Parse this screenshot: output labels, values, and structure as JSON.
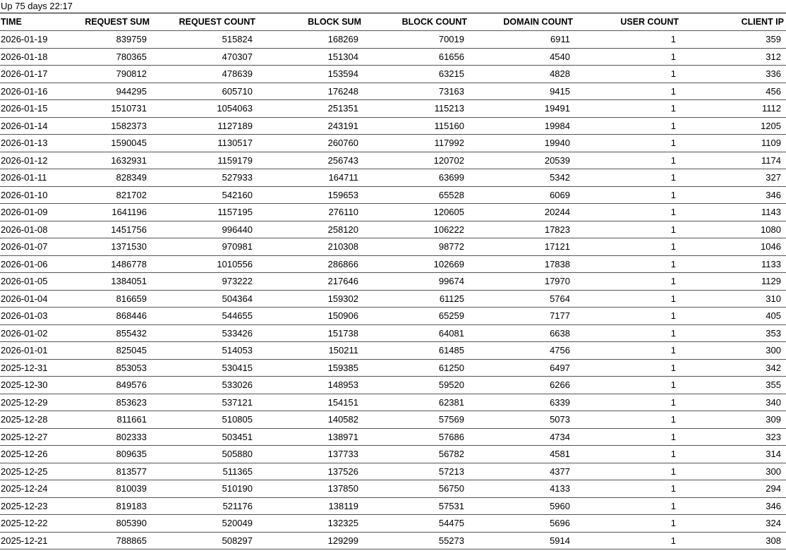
{
  "status": {
    "uptime": "Up 75 days 22:17"
  },
  "table": {
    "headers": [
      "TIME",
      "REQUEST SUM",
      "REQUEST COUNT",
      "BLOCK SUM",
      "BLOCK COUNT",
      "DOMAIN COUNT",
      "USER COUNT",
      "CLIENT IP"
    ],
    "rows": [
      [
        "2026-01-19",
        "839759",
        "515824",
        "168269",
        "70019",
        "6911",
        "1",
        "359"
      ],
      [
        "2026-01-18",
        "780365",
        "470307",
        "151304",
        "61656",
        "4540",
        "1",
        "312"
      ],
      [
        "2026-01-17",
        "790812",
        "478639",
        "153594",
        "63215",
        "4828",
        "1",
        "336"
      ],
      [
        "2026-01-16",
        "944295",
        "605710",
        "176248",
        "73163",
        "9415",
        "1",
        "456"
      ],
      [
        "2026-01-15",
        "1510731",
        "1054063",
        "251351",
        "115213",
        "19491",
        "1",
        "1112"
      ],
      [
        "2026-01-14",
        "1582373",
        "1127189",
        "243191",
        "115160",
        "19984",
        "1",
        "1205"
      ],
      [
        "2026-01-13",
        "1590045",
        "1130517",
        "260760",
        "117992",
        "19940",
        "1",
        "1109"
      ],
      [
        "2026-01-12",
        "1632931",
        "1159179",
        "256743",
        "120702",
        "20539",
        "1",
        "1174"
      ],
      [
        "2026-01-11",
        "828349",
        "527933",
        "164711",
        "63699",
        "5342",
        "1",
        "327"
      ],
      [
        "2026-01-10",
        "821702",
        "542160",
        "159653",
        "65528",
        "6069",
        "1",
        "346"
      ],
      [
        "2026-01-09",
        "1641196",
        "1157195",
        "276110",
        "120605",
        "20244",
        "1",
        "1143"
      ],
      [
        "2026-01-08",
        "1451756",
        "996440",
        "258120",
        "106222",
        "17823",
        "1",
        "1080"
      ],
      [
        "2026-01-07",
        "1371530",
        "970981",
        "210308",
        "98772",
        "17121",
        "1",
        "1046"
      ],
      [
        "2026-01-06",
        "1486778",
        "1010556",
        "286866",
        "102669",
        "17838",
        "1",
        "1133"
      ],
      [
        "2026-01-05",
        "1384051",
        "973222",
        "217646",
        "99674",
        "17970",
        "1",
        "1129"
      ],
      [
        "2026-01-04",
        "816659",
        "504364",
        "159302",
        "61125",
        "5764",
        "1",
        "310"
      ],
      [
        "2026-01-03",
        "868446",
        "544655",
        "150906",
        "65259",
        "7177",
        "1",
        "405"
      ],
      [
        "2026-01-02",
        "855432",
        "533426",
        "151738",
        "64081",
        "6638",
        "1",
        "353"
      ],
      [
        "2026-01-01",
        "825045",
        "514053",
        "150211",
        "61485",
        "4756",
        "1",
        "300"
      ],
      [
        "2025-12-31",
        "853053",
        "530415",
        "159385",
        "61250",
        "6497",
        "1",
        "342"
      ],
      [
        "2025-12-30",
        "849576",
        "533026",
        "148953",
        "59520",
        "6266",
        "1",
        "355"
      ],
      [
        "2025-12-29",
        "853623",
        "537121",
        "154151",
        "62381",
        "6339",
        "1",
        "340"
      ],
      [
        "2025-12-28",
        "811661",
        "510805",
        "140582",
        "57569",
        "5073",
        "1",
        "309"
      ],
      [
        "2025-12-27",
        "802333",
        "503451",
        "138971",
        "57686",
        "4734",
        "1",
        "323"
      ],
      [
        "2025-12-26",
        "809635",
        "505880",
        "137733",
        "56782",
        "4581",
        "1",
        "314"
      ],
      [
        "2025-12-25",
        "813577",
        "511365",
        "137526",
        "57213",
        "4377",
        "1",
        "300"
      ],
      [
        "2025-12-24",
        "810039",
        "510190",
        "137850",
        "56750",
        "4133",
        "1",
        "294"
      ],
      [
        "2025-12-23",
        "819183",
        "521176",
        "138119",
        "57531",
        "5960",
        "1",
        "346"
      ],
      [
        "2025-12-22",
        "805390",
        "520049",
        "132325",
        "54475",
        "5696",
        "1",
        "324"
      ],
      [
        "2025-12-21",
        "788865",
        "508297",
        "129299",
        "55273",
        "5914",
        "1",
        "308"
      ]
    ]
  }
}
